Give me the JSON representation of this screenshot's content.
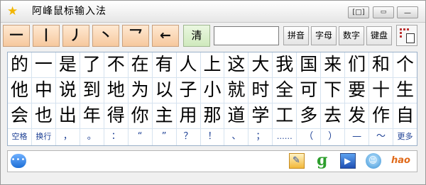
{
  "window": {
    "title": "阿峰鼠标输入法"
  },
  "title_buttons": [
    "mini-mode",
    "restore",
    "minimize"
  ],
  "toolbar": {
    "strokes": [
      "一",
      "丨",
      "丿",
      "丶",
      "乛",
      "←"
    ],
    "clear_label": "清",
    "input_value": "",
    "modes": [
      "拼音",
      "字母",
      "数字",
      "键盘"
    ]
  },
  "candidates": {
    "rows": [
      [
        "的",
        "一",
        "是",
        "了",
        "不",
        "在",
        "有",
        "人",
        "上",
        "这",
        "大",
        "我",
        "国",
        "来",
        "们",
        "和",
        "个"
      ],
      [
        "他",
        "中",
        "说",
        "到",
        "地",
        "为",
        "以",
        "子",
        "小",
        "就",
        "时",
        "全",
        "可",
        "下",
        "要",
        "十",
        "生"
      ],
      [
        "会",
        "也",
        "出",
        "年",
        "得",
        "你",
        "主",
        "用",
        "那",
        "道",
        "学",
        "工",
        "多",
        "去",
        "发",
        "作",
        "自"
      ]
    ],
    "symbols": [
      "空格",
      "换行",
      "，",
      "。",
      "：",
      "“",
      "”",
      "？",
      "！",
      "、",
      "；",
      "……",
      "（",
      "）",
      "—",
      "～",
      "更多"
    ]
  },
  "status_icons": [
    "chat-icon",
    "notepad-icon",
    "refresh-icon",
    "video-icon",
    "mascot-icon",
    "hao-icon"
  ],
  "colors": {
    "stroke_button": "#f6c89e",
    "clear_button": "#cfe9bd",
    "grid_border": "#9ab0c8",
    "symbol_text": "#1c3f94"
  }
}
